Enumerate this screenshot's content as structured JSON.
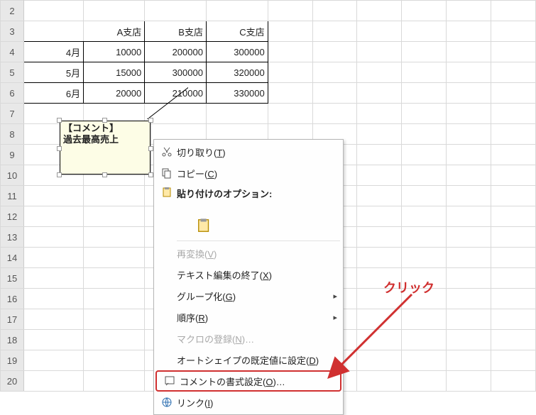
{
  "rows_visible": [
    2,
    3,
    4,
    5,
    6,
    7,
    8,
    9,
    10,
    11,
    12,
    13,
    14,
    15,
    16,
    17,
    18,
    19,
    20
  ],
  "table": {
    "headers": [
      "A支店",
      "B支店",
      "C支店"
    ],
    "row_labels": [
      "4月",
      "5月",
      "6月"
    ],
    "data": [
      [
        10000,
        200000,
        300000
      ],
      [
        15000,
        300000,
        320000
      ],
      [
        20000,
        210000,
        330000
      ]
    ]
  },
  "comment": {
    "title": "【コメント】",
    "body": "過去最高売上"
  },
  "menu": {
    "cut": "切り取り(T)",
    "copy": "コピー(C)",
    "paste_opts": "貼り付けのオプション:",
    "reconvert": "再変換(V)",
    "exit_text_edit": "テキスト編集の終了(X)",
    "group": "グループ化(G)",
    "order": "順序(R)",
    "assign_macro": "マクロの登録(N)…",
    "autoshape_default": "オートシェイプの既定値に設定(D)",
    "format_comment": "コメントの書式設定(O)…",
    "link": "リンク(I)"
  },
  "annotation": {
    "click": "クリック"
  },
  "chart_data": {
    "type": "table",
    "categories": [
      "A支店",
      "B支店",
      "C支店"
    ],
    "series": [
      {
        "name": "4月",
        "values": [
          10000,
          200000,
          300000
        ]
      },
      {
        "name": "5月",
        "values": [
          15000,
          300000,
          320000
        ]
      },
      {
        "name": "6月",
        "values": [
          20000,
          210000,
          330000
        ]
      }
    ],
    "title": "",
    "xlabel": "",
    "ylabel": ""
  }
}
